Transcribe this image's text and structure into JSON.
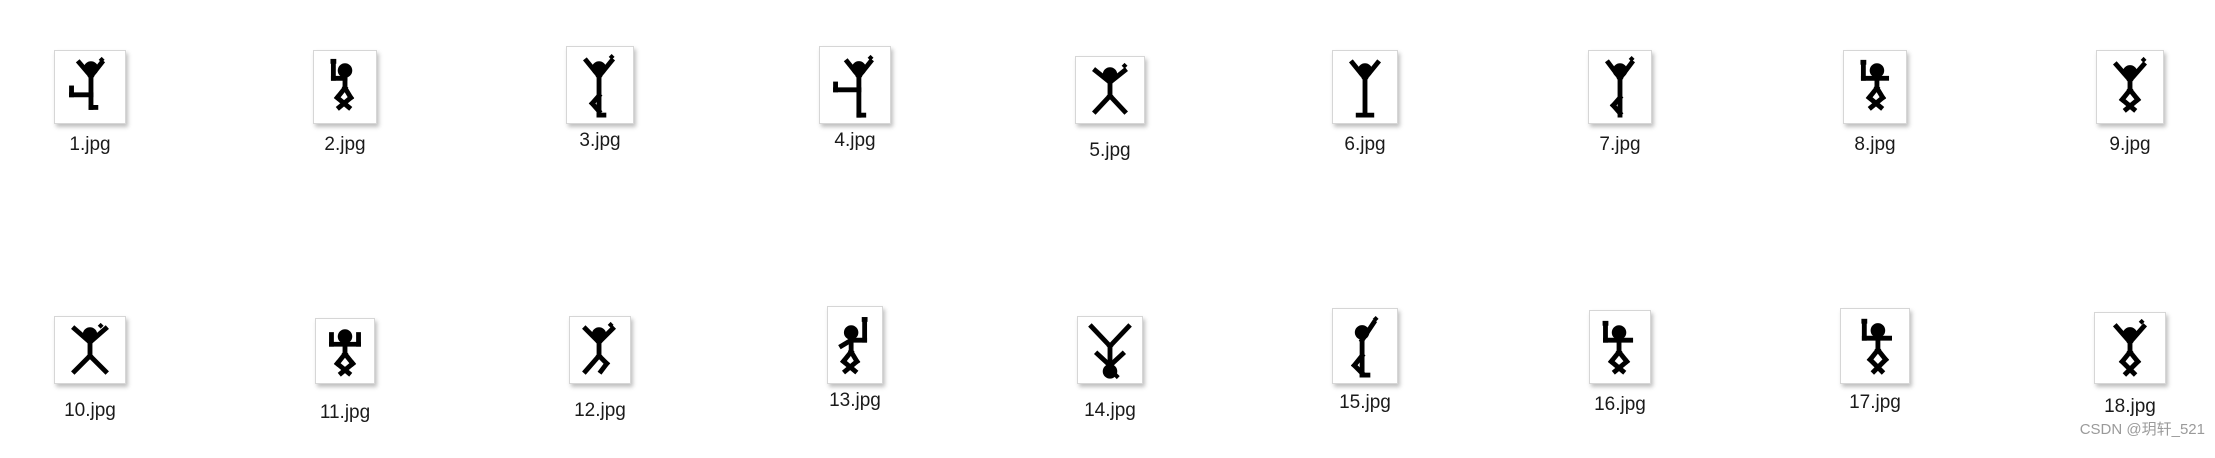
{
  "files": [
    {
      "name": "1.jpg",
      "icon": "dancing-figure-icon"
    },
    {
      "name": "2.jpg",
      "icon": "dancing-figure-icon"
    },
    {
      "name": "3.jpg",
      "icon": "dancing-figure-icon"
    },
    {
      "name": "4.jpg",
      "icon": "dancing-figure-icon"
    },
    {
      "name": "5.jpg",
      "icon": "dancing-figure-icon"
    },
    {
      "name": "6.jpg",
      "icon": "dancing-figure-icon"
    },
    {
      "name": "7.jpg",
      "icon": "dancing-figure-icon"
    },
    {
      "name": "8.jpg",
      "icon": "dancing-figure-icon"
    },
    {
      "name": "9.jpg",
      "icon": "dancing-figure-icon"
    },
    {
      "name": "10.jpg",
      "icon": "dancing-figure-icon"
    },
    {
      "name": "11.jpg",
      "icon": "dancing-figure-icon"
    },
    {
      "name": "12.jpg",
      "icon": "dancing-figure-icon"
    },
    {
      "name": "13.jpg",
      "icon": "dancing-figure-icon"
    },
    {
      "name": "14.jpg",
      "icon": "dancing-figure-icon"
    },
    {
      "name": "15.jpg",
      "icon": "dancing-figure-icon"
    },
    {
      "name": "16.jpg",
      "icon": "dancing-figure-icon"
    },
    {
      "name": "17.jpg",
      "icon": "dancing-figure-icon"
    },
    {
      "name": "18.jpg",
      "icon": "dancing-figure-icon"
    }
  ],
  "watermark": "CSDN @玥轩_521"
}
